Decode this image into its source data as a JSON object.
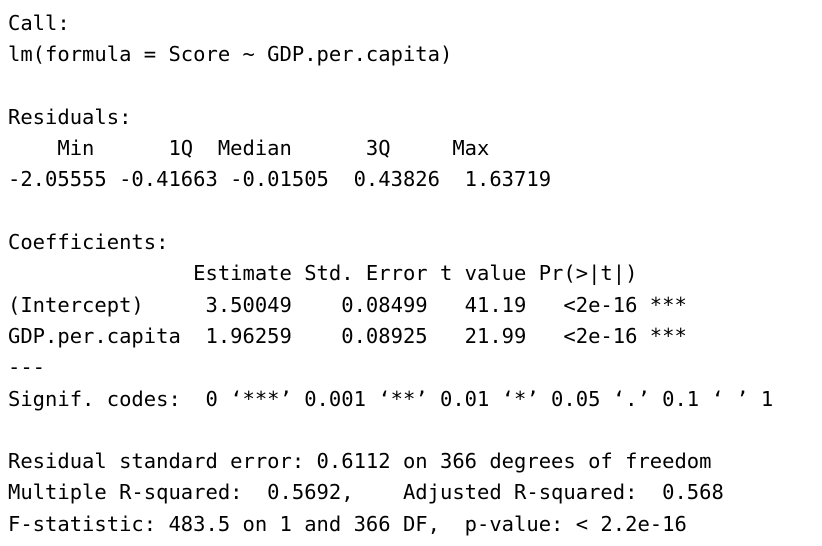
{
  "call": {
    "heading": "Call:",
    "formula": "lm(formula = Score ~ GDP.per.capita)"
  },
  "residuals": {
    "heading": "Residuals:",
    "header": "    Min      1Q  Median      3Q     Max ",
    "values": "-2.05555 -0.41663 -0.01505  0.43826  1.63719 "
  },
  "coefficients": {
    "heading": "Coefficients:",
    "header": "               Estimate Std. Error t value Pr(>|t|)    ",
    "rows": [
      "(Intercept)     3.50049    0.08499   41.19   <2e-16 ***",
      "GDP.per.capita  1.96259    0.08925   21.99   <2e-16 ***"
    ],
    "separator": "---",
    "signif_codes": "Signif. codes:  0 ‘***’ 0.001 ‘**’ 0.01 ‘*’ 0.05 ‘.’ 0.1 ‘ ’ 1"
  },
  "summary": {
    "residual_se": "Residual standard error: 0.6112 on 366 degrees of freedom",
    "r_squared": "Multiple R-squared:  0.5692,\tAdjusted R-squared:  0.568 ",
    "f_statistic": "F-statistic: 483.5 on 1 and 366 DF,  p-value: < 2.2e-16"
  }
}
